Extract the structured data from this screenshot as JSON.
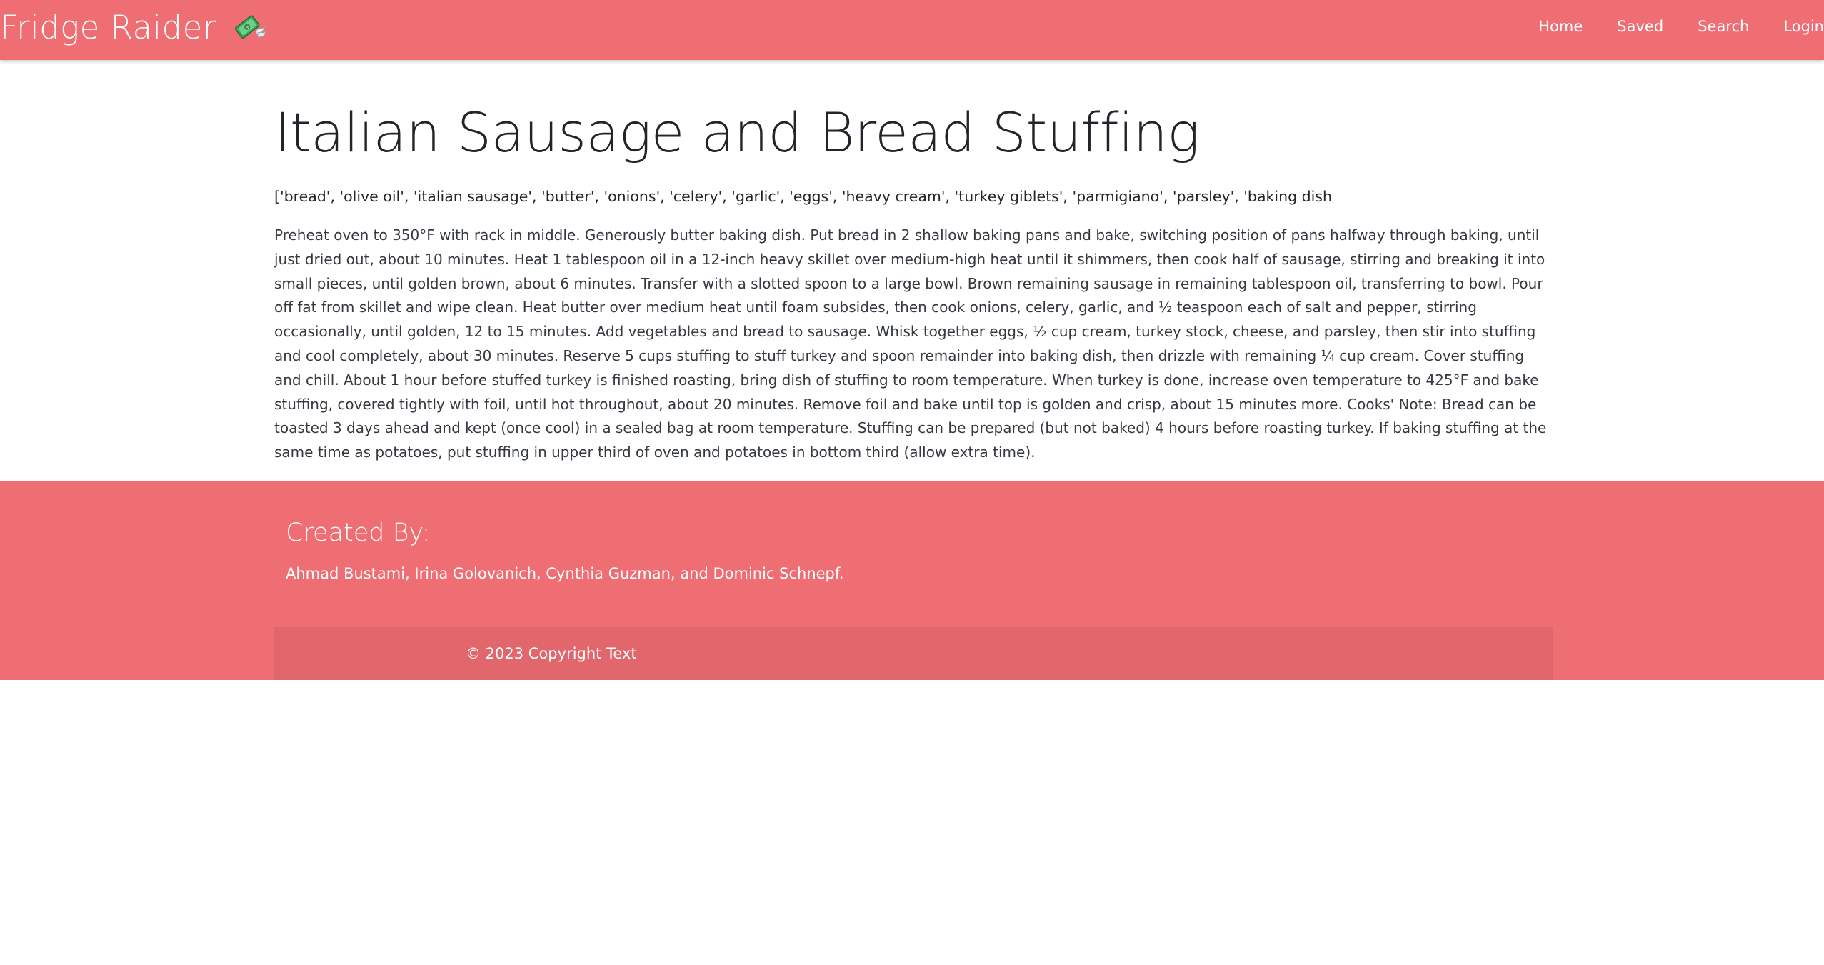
{
  "nav": {
    "brand": "Fridge Raider",
    "brand_icon": "money-with-wings-icon",
    "links": [
      "Home",
      "Saved",
      "Search",
      "Login"
    ]
  },
  "recipe": {
    "title": "Italian Sausage and Bread Stuffing",
    "ingredients": "['bread', 'olive oil', 'italian sausage', 'butter', 'onions', 'celery', 'garlic', 'eggs', 'heavy cream', 'turkey giblets', 'parmigiano', 'parsley', 'baking dish",
    "instructions": "Preheat oven to 350°F with rack in middle. Generously butter baking dish. Put bread in 2 shallow baking pans and bake, switching position of pans halfway through baking, until just dried out, about 10 minutes. Heat 1 tablespoon oil in a 12-inch heavy skillet over medium-high heat until it shimmers, then cook half of sausage, stirring and breaking it into small pieces, until golden brown, about 6 minutes. Transfer with a slotted spoon to a large bowl. Brown remaining sausage in remaining tablespoon oil, transferring to bowl. Pour off fat from skillet and wipe clean. Heat butter over medium heat until foam subsides, then cook onions, celery, garlic, and ½ teaspoon each of salt and pepper, stirring occasionally, until golden, 12 to 15 minutes. Add vegetables and bread to sausage. Whisk together eggs, ½ cup cream, turkey stock, cheese, and parsley, then stir into stuffing and cool completely, about 30 minutes. Reserve 5 cups stuffing to stuff turkey and spoon remainder into baking dish, then drizzle with remaining ¼ cup cream. Cover stuffing and chill. About 1 hour before stuffed turkey is finished roasting, bring dish of stuffing to room temperature. When turkey is done, increase oven temperature to 425°F and bake stuffing, covered tightly with foil, until hot throughout, about 20 minutes. Remove foil and bake until top is golden and crisp, about 15 minutes more. Cooks' Note: Bread can be toasted 3 days ahead and kept (once cool) in a sealed bag at room temperature. Stuffing can be prepared (but not baked) 4 hours before roasting turkey. If baking stuffing at the same time as potatoes, put stuffing in upper third of oven and potatoes in bottom third (allow extra time)."
  },
  "footer": {
    "heading": "Created By:",
    "authors": "Ahmad Bustami, Irina Golovanich, Cynthia Guzman, and Dominic Schnepf.",
    "copyright": "© 2023 Copyright Text"
  },
  "colors": {
    "brand": "#ef6e74",
    "copyright_bar": "#e0676d",
    "text": "#212529"
  }
}
